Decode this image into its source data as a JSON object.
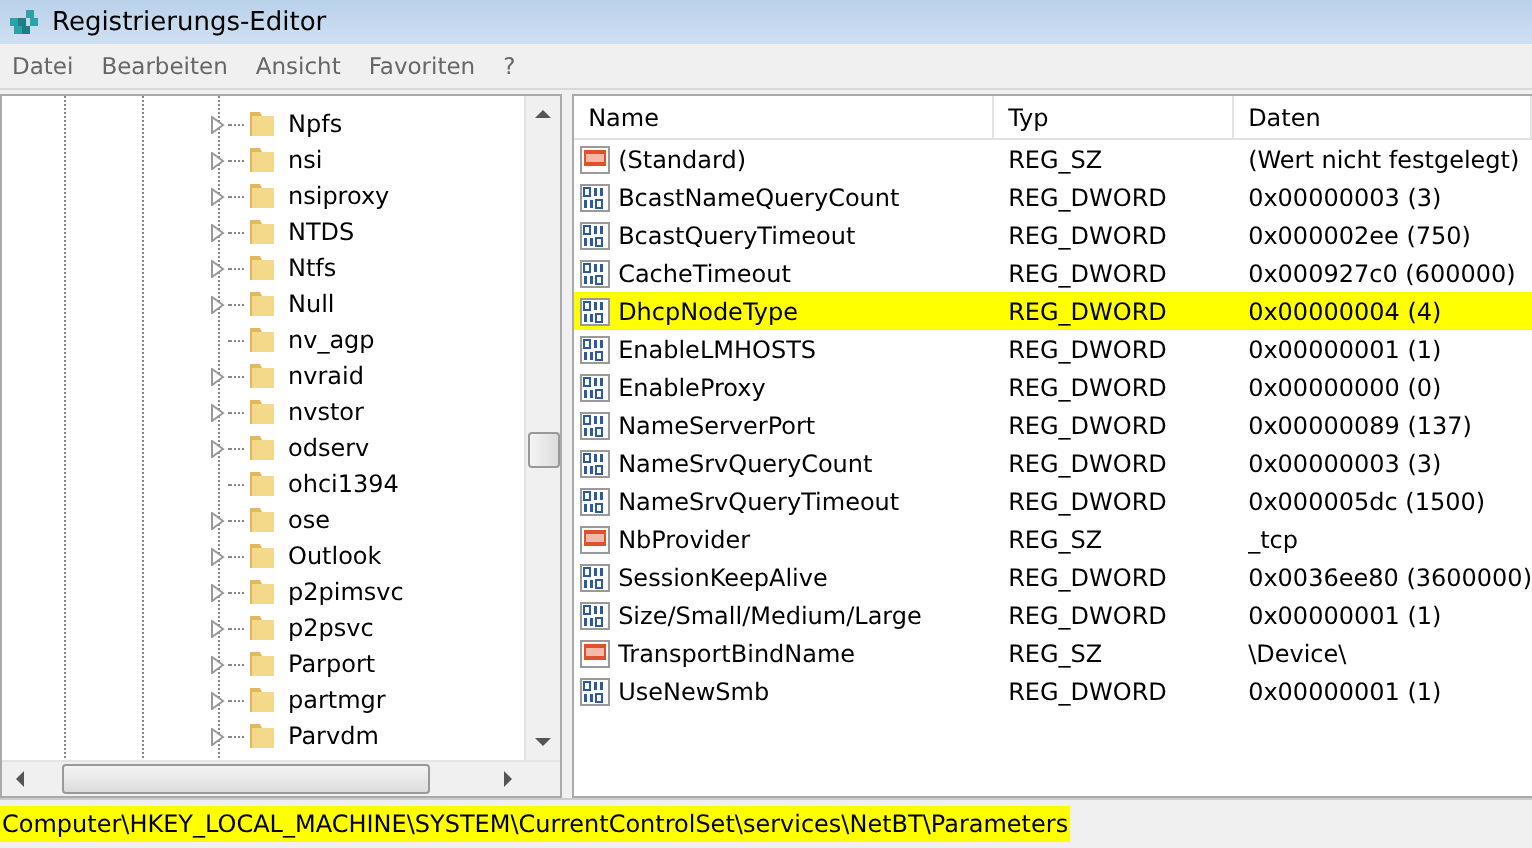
{
  "window": {
    "title": "Registrierungs-Editor"
  },
  "menu": [
    "Datei",
    "Bearbeiten",
    "Ansicht",
    "Favoriten",
    "?"
  ],
  "tree": {
    "items": [
      {
        "label": "Npfs",
        "expandable": true
      },
      {
        "label": "nsi",
        "expandable": true
      },
      {
        "label": "nsiproxy",
        "expandable": true
      },
      {
        "label": "NTDS",
        "expandable": true
      },
      {
        "label": "Ntfs",
        "expandable": true
      },
      {
        "label": "Null",
        "expandable": true
      },
      {
        "label": "nv_agp",
        "expandable": false
      },
      {
        "label": "nvraid",
        "expandable": true
      },
      {
        "label": "nvstor",
        "expandable": true
      },
      {
        "label": "odserv",
        "expandable": true
      },
      {
        "label": "ohci1394",
        "expandable": false
      },
      {
        "label": "ose",
        "expandable": true
      },
      {
        "label": "Outlook",
        "expandable": true
      },
      {
        "label": "p2pimsvc",
        "expandable": true
      },
      {
        "label": "p2psvc",
        "expandable": true
      },
      {
        "label": "Parport",
        "expandable": true
      },
      {
        "label": "partmgr",
        "expandable": true
      },
      {
        "label": "Parvdm",
        "expandable": true
      }
    ]
  },
  "table": {
    "columns": [
      "Name",
      "Typ",
      "Daten"
    ],
    "rows": [
      {
        "kind": "string",
        "name": "(Standard)",
        "type": "REG_SZ",
        "data": "(Wert nicht festgelegt)",
        "highlighted": false
      },
      {
        "kind": "binary",
        "name": "BcastNameQueryCount",
        "type": "REG_DWORD",
        "data": "0x00000003 (3)",
        "highlighted": false
      },
      {
        "kind": "binary",
        "name": "BcastQueryTimeout",
        "type": "REG_DWORD",
        "data": "0x000002ee (750)",
        "highlighted": false
      },
      {
        "kind": "binary",
        "name": "CacheTimeout",
        "type": "REG_DWORD",
        "data": "0x000927c0 (600000)",
        "highlighted": false
      },
      {
        "kind": "binary",
        "name": "DhcpNodeType",
        "type": "REG_DWORD",
        "data": "0x00000004 (4)",
        "highlighted": true
      },
      {
        "kind": "binary",
        "name": "EnableLMHOSTS",
        "type": "REG_DWORD",
        "data": "0x00000001 (1)",
        "highlighted": false
      },
      {
        "kind": "binary",
        "name": "EnableProxy",
        "type": "REG_DWORD",
        "data": "0x00000000 (0)",
        "highlighted": false
      },
      {
        "kind": "binary",
        "name": "NameServerPort",
        "type": "REG_DWORD",
        "data": "0x00000089 (137)",
        "highlighted": false
      },
      {
        "kind": "binary",
        "name": "NameSrvQueryCount",
        "type": "REG_DWORD",
        "data": "0x00000003 (3)",
        "highlighted": false
      },
      {
        "kind": "binary",
        "name": "NameSrvQueryTimeout",
        "type": "REG_DWORD",
        "data": "0x000005dc (1500)",
        "highlighted": false
      },
      {
        "kind": "string",
        "name": "NbProvider",
        "type": "REG_SZ",
        "data": "_tcp",
        "highlighted": false
      },
      {
        "kind": "binary",
        "name": "SessionKeepAlive",
        "type": "REG_DWORD",
        "data": "0x0036ee80 (3600000)",
        "highlighted": false
      },
      {
        "kind": "binary",
        "name": "Size/Small/Medium/Large",
        "type": "REG_DWORD",
        "data": "0x00000001 (1)",
        "highlighted": false
      },
      {
        "kind": "string",
        "name": "TransportBindName",
        "type": "REG_SZ",
        "data": "\\Device\\",
        "highlighted": false
      },
      {
        "kind": "binary",
        "name": "UseNewSmb",
        "type": "REG_DWORD",
        "data": "0x00000001 (1)",
        "highlighted": false
      }
    ]
  },
  "status_bar": {
    "path": "Computer\\HKEY_LOCAL_MACHINE\\SYSTEM\\CurrentControlSet\\services\\NetBT\\Parameters",
    "highlighted": true
  }
}
